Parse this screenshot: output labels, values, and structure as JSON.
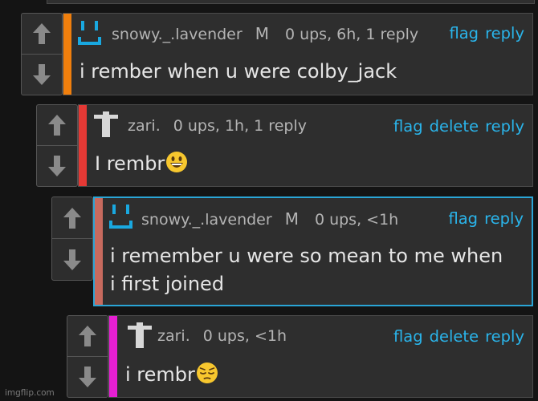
{
  "colors": {
    "accent_link": "#2ab4ea",
    "bar_c1": "#f07f0d",
    "bar_c2": "#e53935",
    "bar_c3": "#c76a5e",
    "bar_c4": "#e61fd2",
    "highlight_border": "#2aa5d6"
  },
  "comments": [
    {
      "avatar_icon": "smiley-face-icon",
      "username": "snowy._.lavender",
      "role_badge": "M",
      "meta": "0 ups, 6h, 1 reply",
      "actions": [
        "flag",
        "reply"
      ],
      "text": "i rember when u were colby_jack"
    },
    {
      "avatar_icon": "shirt-icon",
      "username": "zari.",
      "meta": "0 ups, 1h, 1 reply",
      "actions": [
        "flag",
        "delete",
        "reply"
      ],
      "text": "I rembr",
      "emoji": "grinning-face-emoji"
    },
    {
      "avatar_icon": "smiley-face-icon",
      "username": "snowy._.lavender",
      "role_badge": "M",
      "meta": "0 ups, <1h",
      "actions": [
        "flag",
        "reply"
      ],
      "text_line1": "i remember u were so mean to me when",
      "text_line2": "i first joined"
    },
    {
      "avatar_icon": "shirt-icon",
      "username": "zari.",
      "meta": "0 ups, <1h",
      "actions": [
        "flag",
        "delete",
        "reply"
      ],
      "text": "i rembr",
      "emoji": "pensive-face-emoji"
    }
  ],
  "watermark": "imgflip.com"
}
